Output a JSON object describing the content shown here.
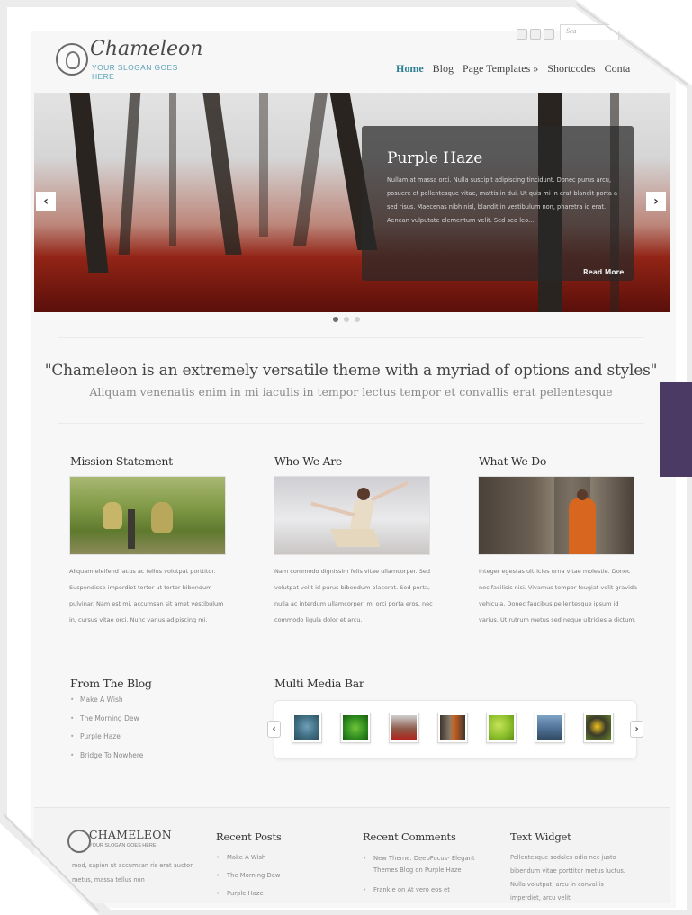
{
  "header": {
    "logo_title": "Chameleon",
    "slogan": "YOUR SLOGAN GOES HERE",
    "search_placeholder": "Sea"
  },
  "nav": {
    "items": [
      "Home",
      "Blog",
      "Page Templates »",
      "Shortcodes",
      "Conta"
    ]
  },
  "slider": {
    "title": "Purple Haze",
    "text": "Nullam at massa orci. Nulla suscipit adipiscing tincidunt. Donec purus arcu, posuere et pellentesque vitae, mattis in dui. Ut quis mi in erat blandit porta a sed risus. Maecenas nibh nisl, blandit in vestibulum non, pharetra id erat. Aenean vulputate elementum velit. Sed sed leo...",
    "read_more": "Read More",
    "prev": "‹",
    "next": "›"
  },
  "tagline": {
    "quote": "\"Chameleon is an extremely versatile theme with a myriad of options and styles\"",
    "sub": "Aliquam venenatis enim in mi iaculis in tempor lectus tempor et convallis erat pellentesque"
  },
  "columns": [
    {
      "title": "Mission Statement",
      "text": "Aliquam eleifend lacus ac tellus volutpat porttitor. Suspendisse imperdiet tortor ut tortor bibendum pulvinar. Nam est mi, accumsan sit amet vestibulum in, cursus vitae orci. Nunc varius adipiscing mi."
    },
    {
      "title": "Who We Are",
      "text": "Nam commodo dignissim felis vitae ullamcorper. Sed volutpat velit id purus bibendum placerat. Sed porta, nulla ac interdum ullamcorper, mi orci porta eros, nec commodo ligula dolor et arcu."
    },
    {
      "title": "What We Do",
      "text": "Integer egestas ultricies urna vitae molestie. Donec nec facilisis nisi. Vivamus tempor feugiat velit gravida vehicula. Donec faucibus pellentesque ipsum id varius. Ut rutrum metus sed neque ultricies a dictum."
    }
  ],
  "blog": {
    "title": "From The Blog",
    "items": [
      "Make A Wish",
      "The Morning Dew",
      "Purple Haze",
      "Bridge To Nowhere"
    ]
  },
  "media_bar": {
    "title": "Multi Media Bar",
    "prev": "‹",
    "next": "›"
  },
  "footer": {
    "logo_title": "CHAMELEON",
    "logo_slogan": "YOUR SLOGAN GOES HERE",
    "about_text": "mod, sapien ut accumsan ris erat auctor metus, massa tellus non",
    "recent_posts": {
      "title": "Recent Posts",
      "items": [
        "Make A Wish",
        "The Morning Dew",
        "Purple Haze"
      ]
    },
    "recent_comments": {
      "title": "Recent Comments",
      "items": [
        "New Theme: DeepFocus- Elegant Themes Blog on Purple Haze",
        "Frankie on At vero eos et"
      ]
    },
    "text_widget": {
      "title": "Text Widget",
      "text": "Pellentesque sodales odio nec justo bibendum vitae porttitor metus luctus. Nulla volutpat, arcu in convallis imperdiet, arcu velit"
    }
  },
  "colors": {
    "accent": "#2f7f94",
    "purple_box": "#4a3a64"
  }
}
